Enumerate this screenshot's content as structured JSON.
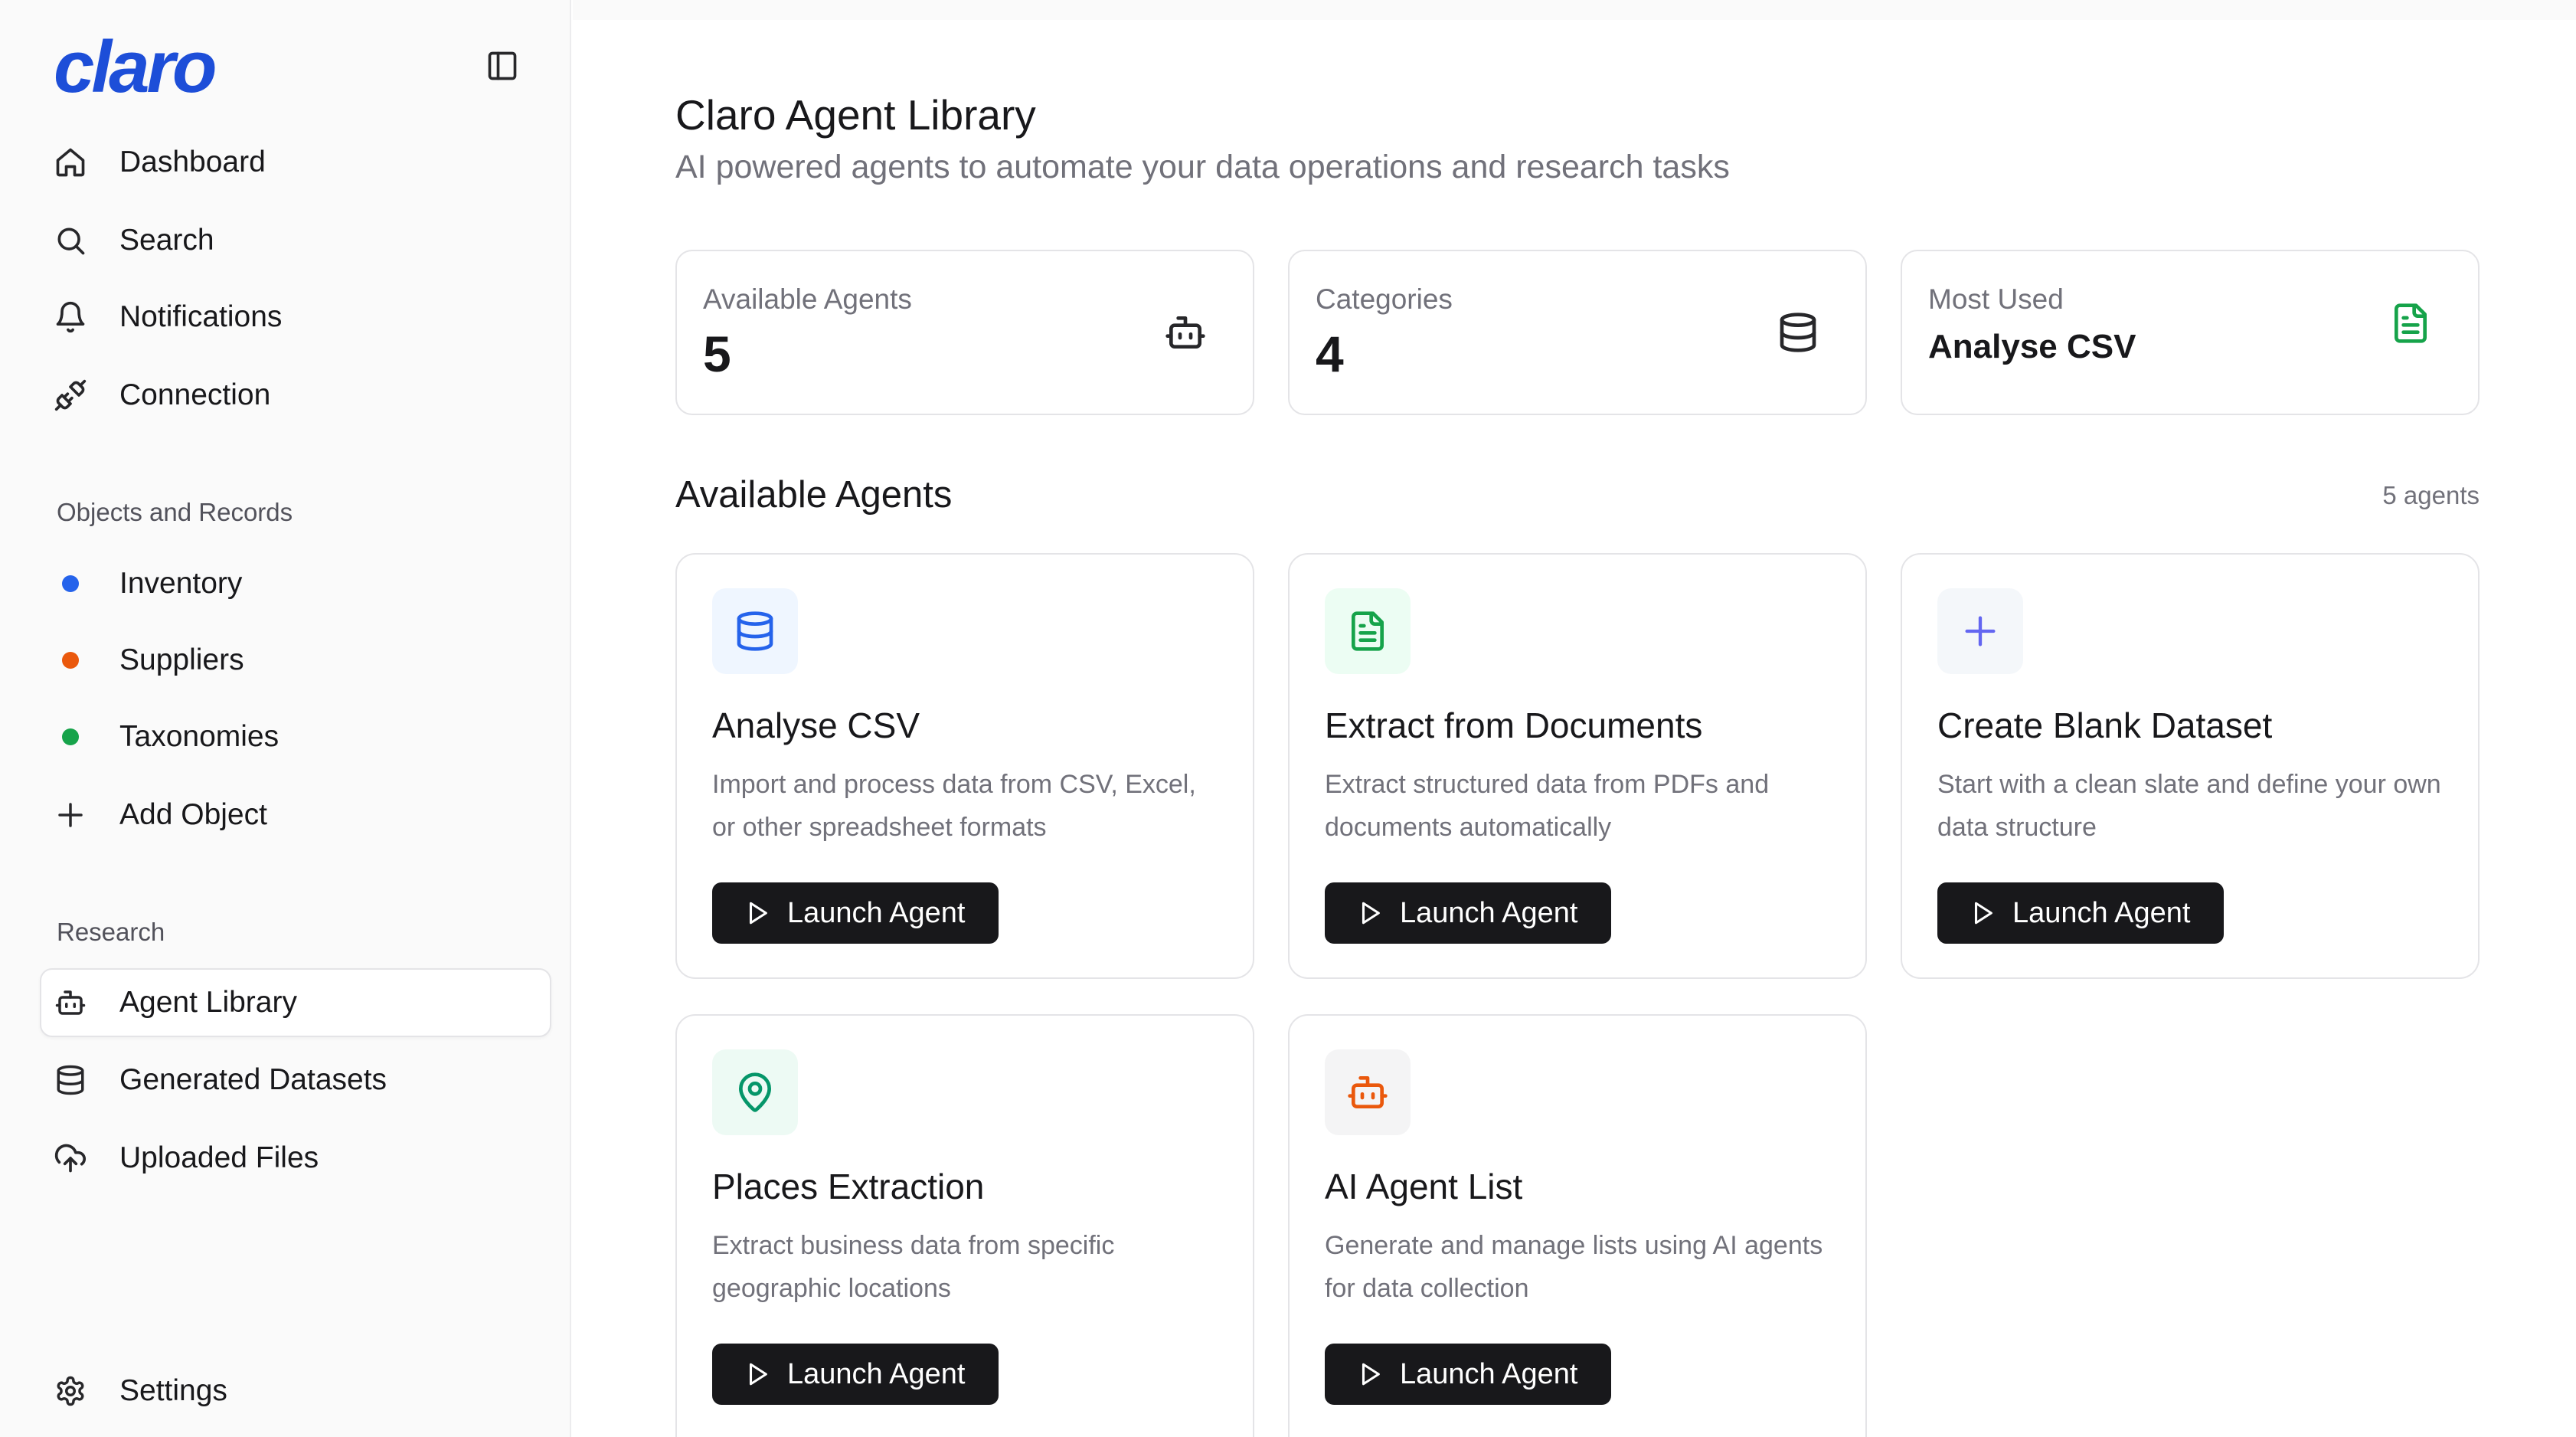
{
  "app": {
    "logo_text": "claro",
    "brand_color": "#1d4ed8"
  },
  "sidebar": {
    "primary_items": [
      {
        "label": "Dashboard",
        "icon": "home-icon"
      },
      {
        "label": "Search",
        "icon": "search-icon"
      },
      {
        "label": "Notifications",
        "icon": "bell-icon"
      },
      {
        "label": "Connection",
        "icon": "plug-icon"
      }
    ],
    "objects_section": {
      "label": "Objects and Records",
      "items": [
        {
          "label": "Inventory",
          "dot_color": "#2563eb"
        },
        {
          "label": "Suppliers",
          "dot_color": "#ea580c"
        },
        {
          "label": "Taxonomies",
          "dot_color": "#16a34a"
        }
      ],
      "add_label": "Add Object"
    },
    "research_section": {
      "label": "Research",
      "items": [
        {
          "label": "Agent Library",
          "icon": "bot-icon",
          "active": true
        },
        {
          "label": "Generated Datasets",
          "icon": "database-icon"
        },
        {
          "label": "Uploaded Files",
          "icon": "cloud-upload-icon"
        }
      ]
    },
    "settings_label": "Settings"
  },
  "main": {
    "title": "Claro Agent Library",
    "subtitle": "AI powered agents to automate your data operations and research tasks",
    "stats": [
      {
        "label": "Available Agents",
        "value": "5",
        "icon": "bot-icon"
      },
      {
        "label": "Categories",
        "value": "4",
        "icon": "database-icon"
      },
      {
        "label": "Most Used",
        "value": "Analyse CSV",
        "icon": "file-text-icon",
        "icon_color": "#16a34a"
      }
    ],
    "section_title": "Available Agents",
    "section_count": "5 agents",
    "agents": [
      {
        "title": "Analyse CSV",
        "description": "Import and process data from CSV, Excel, or other spreadsheet formats",
        "icon": "database-icon",
        "icon_color": "#2563eb",
        "icon_bg": "#eff6ff",
        "button": "Launch Agent"
      },
      {
        "title": "Extract from Documents",
        "description": "Extract structured data from PDFs and documents automatically",
        "icon": "file-text-icon",
        "icon_color": "#16a34a",
        "icon_bg": "#ecfdf3",
        "button": "Launch Agent"
      },
      {
        "title": "Create Blank Dataset",
        "description": "Start with a clean slate and define your own data structure",
        "icon": "plus-icon",
        "icon_color": "#6366f1",
        "icon_bg": "#f4f7fa",
        "button": "Launch Agent"
      },
      {
        "title": "Places Extraction",
        "description": "Extract business data from specific geographic locations",
        "icon": "map-pin-icon",
        "icon_color": "#059669",
        "icon_bg": "#edfaf4",
        "button": "Launch Agent"
      },
      {
        "title": "AI Agent List",
        "description": "Generate and manage lists using AI agents for data collection",
        "icon": "bot-icon",
        "icon_color": "#ea580c",
        "icon_bg": "#f4f4f5",
        "button": "Launch Agent"
      }
    ]
  }
}
